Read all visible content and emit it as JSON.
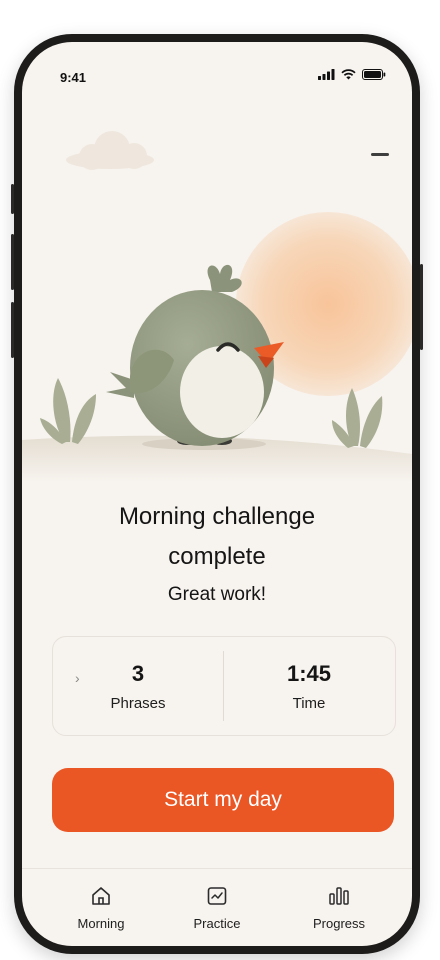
{
  "status_bar": {
    "time": "9:41",
    "icons": [
      "signal-icon",
      "wifi-icon",
      "battery-icon"
    ]
  },
  "header": {
    "menu_icon": "menu-icon"
  },
  "illustration": {
    "character": "smiling green bird mascot",
    "colors": {
      "bird_body": "#9aa28a",
      "beak": "#ea5b28",
      "sun": "#f6c9a0",
      "hill": "#ebe5db"
    }
  },
  "main": {
    "headline": "Morning challenge complete",
    "subline": "Great work!"
  },
  "stats": [
    {
      "value": "3",
      "label": "Phrases"
    },
    {
      "value": "1:45",
      "label": "Time"
    }
  ],
  "cta": {
    "label": "Start my day",
    "color": "#eb5625"
  },
  "tabs": [
    {
      "label": "Morning",
      "icon": "home-icon"
    },
    {
      "label": "Practice",
      "icon": "practice-card-icon"
    },
    {
      "label": "Progress",
      "icon": "bar-chart-icon"
    }
  ]
}
